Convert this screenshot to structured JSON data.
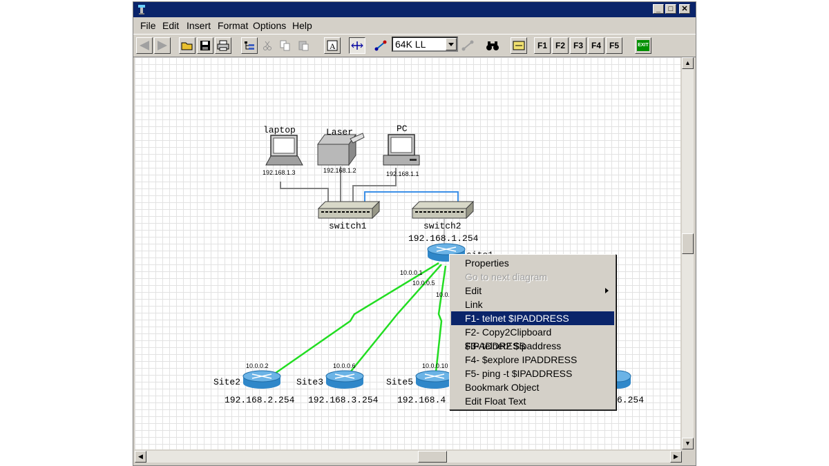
{
  "window": {
    "menu": [
      "File",
      "Edit",
      "Insert",
      "Format",
      "Options",
      "Help"
    ],
    "controls": {
      "minimize": "_",
      "maximize": "□",
      "close": "✕"
    }
  },
  "toolbar": {
    "link_speed": "64K LL",
    "fkeys": [
      "F1",
      "F2",
      "F3",
      "F4",
      "F5"
    ],
    "exit_label": "EXIT"
  },
  "diagram": {
    "devices": {
      "laptop": {
        "label": "laptop",
        "ip": "192.168.1.3"
      },
      "laser": {
        "label": "Laser",
        "ip": "192.168.1.2"
      },
      "pc": {
        "label": "PC",
        "ip": "192.168.1.1"
      },
      "switch1": {
        "label": "switch1"
      },
      "switch2": {
        "label": "switch2"
      },
      "site1": {
        "label": "site1",
        "ip": "192.168.1.254"
      }
    },
    "link_ips": {
      "site1_a": "10.0.0.1",
      "site1_b": "10.0.0.5",
      "site1_c": "10.0.",
      "site2": "10.0.0.2",
      "site3": "10.0.0.6",
      "site5": "10.0.0.10"
    },
    "sites": [
      {
        "label": "Site2",
        "ip": "192.168.2.254"
      },
      {
        "label": "Site3",
        "ip": "192.168.3.254"
      },
      {
        "label": "Site5",
        "ip": "192.168.4"
      },
      {
        "label": "",
        "ip": "6.254"
      }
    ]
  },
  "context_menu": {
    "items": [
      {
        "label": "Properties",
        "state": "normal"
      },
      {
        "label": "Go to next diagram",
        "state": "disabled"
      },
      {
        "label": "Edit",
        "state": "submenu"
      },
      {
        "label": "Link",
        "state": "normal"
      },
      {
        "label": "F1- telnet $IPADDRESS",
        "state": "selected"
      },
      {
        "label": "F2- Copy2Clipboard $IPADDRESS",
        "state": "normal"
      },
      {
        "label": "F3- telnet2 $ipaddress",
        "state": "normal"
      },
      {
        "label": "F4- $explore IPADDRESS",
        "state": "normal"
      },
      {
        "label": "F5- ping -t $IPADDRESS",
        "state": "normal"
      },
      {
        "label": "Bookmark Object",
        "state": "normal"
      },
      {
        "label": "Edit Float Text",
        "state": "normal"
      }
    ]
  },
  "colors": {
    "titlebar": "#0a246a",
    "selection": "#0a246a",
    "wan_link": "#22dd22",
    "lan_link_blue": "#3a8ee6",
    "lan_link_gray": "#808080",
    "router": "#2f87c9"
  }
}
